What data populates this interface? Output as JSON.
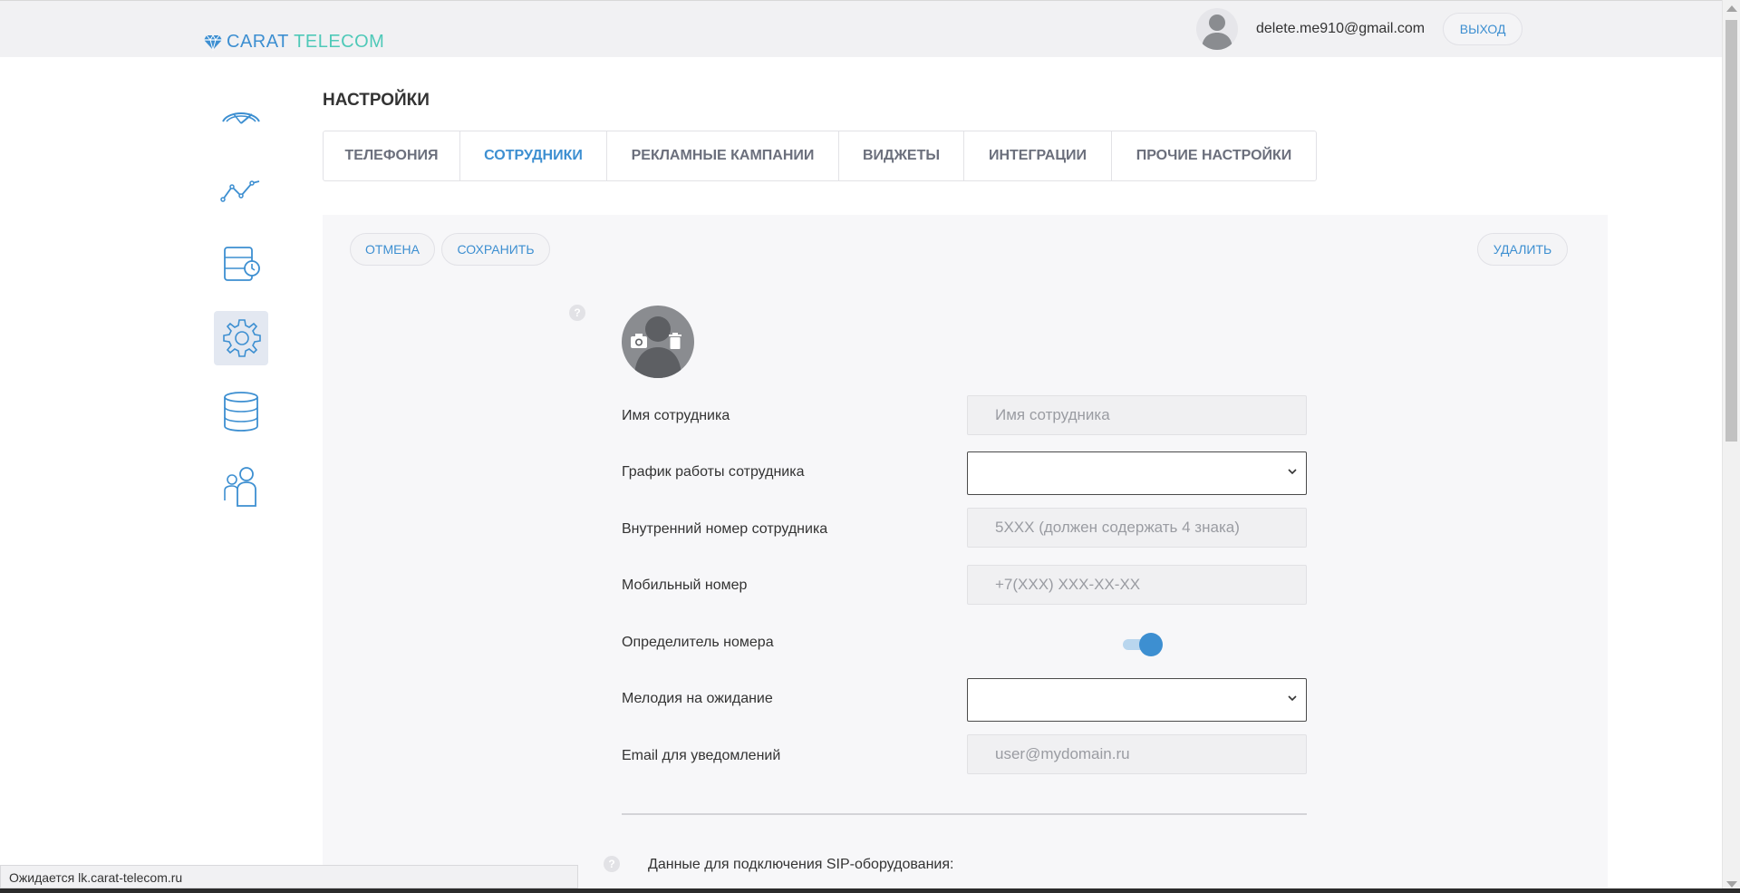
{
  "header": {
    "logo_part1": "CARAT",
    "logo_part2": "TELECOM",
    "user_email": "delete.me910@gmail.com",
    "logout_label": "ВЫХОД"
  },
  "sidebar": {
    "items": [
      {
        "name": "dashboard",
        "icon": "gauge-icon",
        "active": false
      },
      {
        "name": "analytics",
        "icon": "line-chart-icon",
        "active": false
      },
      {
        "name": "call-history",
        "icon": "calendar-clock-icon",
        "active": false
      },
      {
        "name": "settings",
        "icon": "gear-icon",
        "active": true
      },
      {
        "name": "database",
        "icon": "database-icon",
        "active": false
      },
      {
        "name": "employees",
        "icon": "users-icon",
        "active": false
      }
    ]
  },
  "page": {
    "title": "НАСТРОЙКИ",
    "tabs": [
      {
        "label": "ТЕЛЕФОНИЯ",
        "active": false
      },
      {
        "label": "СОТРУДНИКИ",
        "active": true
      },
      {
        "label": "РЕКЛАМНЫЕ КАМПАНИИ",
        "active": false
      },
      {
        "label": "ВИДЖЕТЫ",
        "active": false
      },
      {
        "label": "ИНТЕГРАЦИИ",
        "active": false
      },
      {
        "label": "ПРОЧИЕ НАСТРОЙКИ",
        "active": false
      }
    ]
  },
  "actions": {
    "cancel": "ОТМЕНА",
    "save": "СОХРАНИТЬ",
    "delete": "УДАЛИТЬ"
  },
  "help_icon": "?",
  "form": {
    "name": {
      "label": "Имя сотрудника",
      "placeholder": "Имя сотрудника",
      "value": ""
    },
    "schedule": {
      "label": "График работы сотрудника",
      "value": ""
    },
    "extension": {
      "label": "Внутренний номер сотрудника",
      "placeholder": "5XXX (должен содержать 4 знака)",
      "value": ""
    },
    "mobile": {
      "label": "Мобильный номер",
      "placeholder": "+7(XXX) XXX-XX-XX",
      "value": ""
    },
    "caller_id": {
      "label": "Определитель номера",
      "enabled": true
    },
    "hold_music": {
      "label": "Мелодия на ожидание",
      "value": ""
    },
    "email": {
      "label": "Email для уведомлений",
      "placeholder": "user@mydomain.ru",
      "value": ""
    }
  },
  "sip_section": {
    "label": "Данные для подключения SIP-оборудования:"
  },
  "status_bar": {
    "text": "Ожидается lk.carat-telecom.ru"
  },
  "colors": {
    "accent": "#3d8fd1",
    "logo_teal": "#4fc9b8",
    "topbar_bg": "#f1f1f3",
    "panel_bg": "#f7f7f9"
  }
}
